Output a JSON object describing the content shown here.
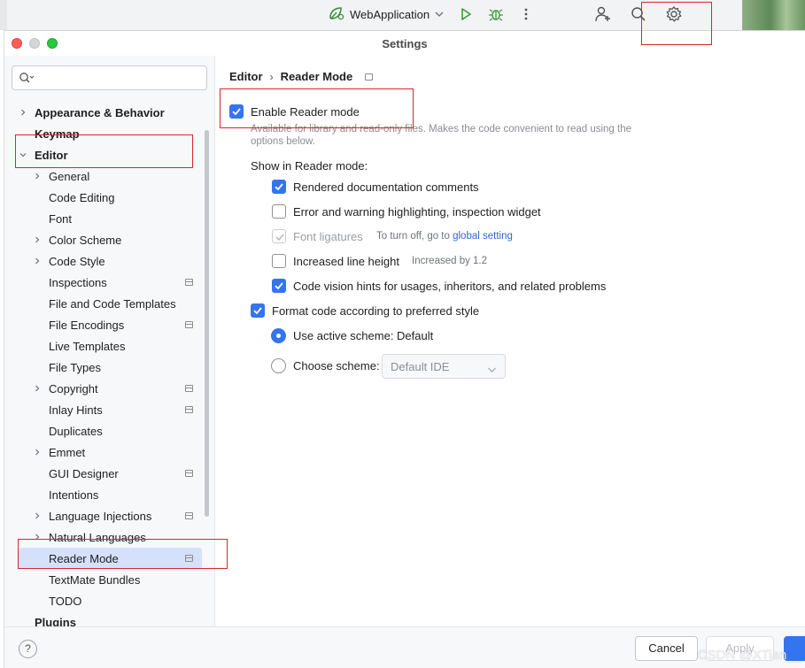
{
  "toolbar": {
    "run_config": "WebApplication"
  },
  "dialog": {
    "title": "Settings"
  },
  "sidebar": {
    "search_placeholder": "",
    "items": [
      {
        "label": "Appearance & Behavior",
        "bold": true,
        "expandable": true
      },
      {
        "label": "Keymap",
        "bold": true,
        "expandable": false
      },
      {
        "label": "Editor",
        "bold": true,
        "expandable": true,
        "expanded": true
      },
      {
        "label": "General",
        "expandable": true
      },
      {
        "label": "Code Editing"
      },
      {
        "label": "Font"
      },
      {
        "label": "Color Scheme",
        "expandable": true
      },
      {
        "label": "Code Style",
        "expandable": true
      },
      {
        "label": "Inspections",
        "project_marker": true
      },
      {
        "label": "File and Code Templates"
      },
      {
        "label": "File Encodings",
        "project_marker": true
      },
      {
        "label": "Live Templates"
      },
      {
        "label": "File Types"
      },
      {
        "label": "Copyright",
        "expandable": true,
        "project_marker": true
      },
      {
        "label": "Inlay Hints",
        "project_marker": true
      },
      {
        "label": "Duplicates"
      },
      {
        "label": "Emmet",
        "expandable": true
      },
      {
        "label": "GUI Designer",
        "project_marker": true
      },
      {
        "label": "Intentions"
      },
      {
        "label": "Language Injections",
        "expandable": true,
        "project_marker": true
      },
      {
        "label": "Natural Languages",
        "expandable": true
      },
      {
        "label": "Reader Mode",
        "selected": true,
        "project_marker": true
      },
      {
        "label": "TextMate Bundles"
      },
      {
        "label": "TODO"
      },
      {
        "label": "Plugins",
        "bold": true
      }
    ]
  },
  "content": {
    "breadcrumb": [
      "Editor",
      "Reader Mode"
    ],
    "enable_label": "Enable Reader mode",
    "enable_checked": true,
    "enable_hint_line1": "Available for library and read-only files. Makes the code convenient to read using the",
    "enable_hint_line2": "options below.",
    "show_in_label": "Show in Reader mode:",
    "options": [
      {
        "label": "Rendered documentation comments",
        "state": "checked"
      },
      {
        "label": "Error and warning highlighting, inspection widget",
        "state": "unchecked"
      },
      {
        "label": "Font ligatures",
        "state": "disabled-checked",
        "hint": "To turn off, go to ",
        "hint_link": "global setting"
      },
      {
        "label": "Increased line height",
        "state": "unchecked",
        "hint": "Increased by 1.2"
      },
      {
        "label": "Code vision hints for usages, inheritors, and related problems",
        "state": "checked"
      }
    ],
    "format_label": "Format code according to preferred style",
    "format_checked": true,
    "radio_active": "Use active scheme: Default",
    "radio_choose": "Choose scheme:",
    "scheme_value": "Default  IDE"
  },
  "footer": {
    "help": "?",
    "cancel": "Cancel",
    "apply": "Apply"
  },
  "watermark": "CSDN @XTian__",
  "colors": {
    "accent": "#3574f0",
    "highlight_box": "#d9262b",
    "selection": "#d5e1fb"
  }
}
